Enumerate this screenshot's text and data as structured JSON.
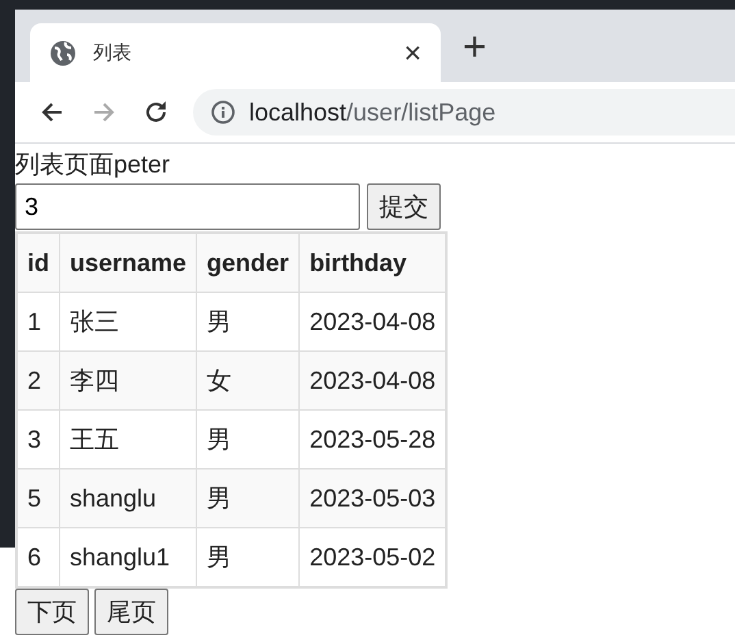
{
  "browser": {
    "tabs": [
      {
        "title": "列表",
        "selected": true
      }
    ],
    "new_tab": "+",
    "close": "×",
    "address": {
      "host": "localhost",
      "path": "/user/listPage"
    }
  },
  "page": {
    "heading": "列表页面peter",
    "search": {
      "value": "3"
    },
    "submit": "提交",
    "table": {
      "columns": [
        "id",
        "username",
        "gender",
        "birthday"
      ],
      "rows": [
        [
          "1",
          "张三",
          "男",
          "2023-04-08"
        ],
        [
          "2",
          "李四",
          "女",
          "2023-04-08"
        ],
        [
          "3",
          "王五",
          "男",
          "2023-05-28"
        ],
        [
          "5",
          "shanglu",
          "男",
          "2023-05-03"
        ],
        [
          "6",
          "shanglu1",
          "男",
          "2023-05-02"
        ]
      ]
    },
    "pager": [
      "下页",
      "尾页"
    ]
  }
}
